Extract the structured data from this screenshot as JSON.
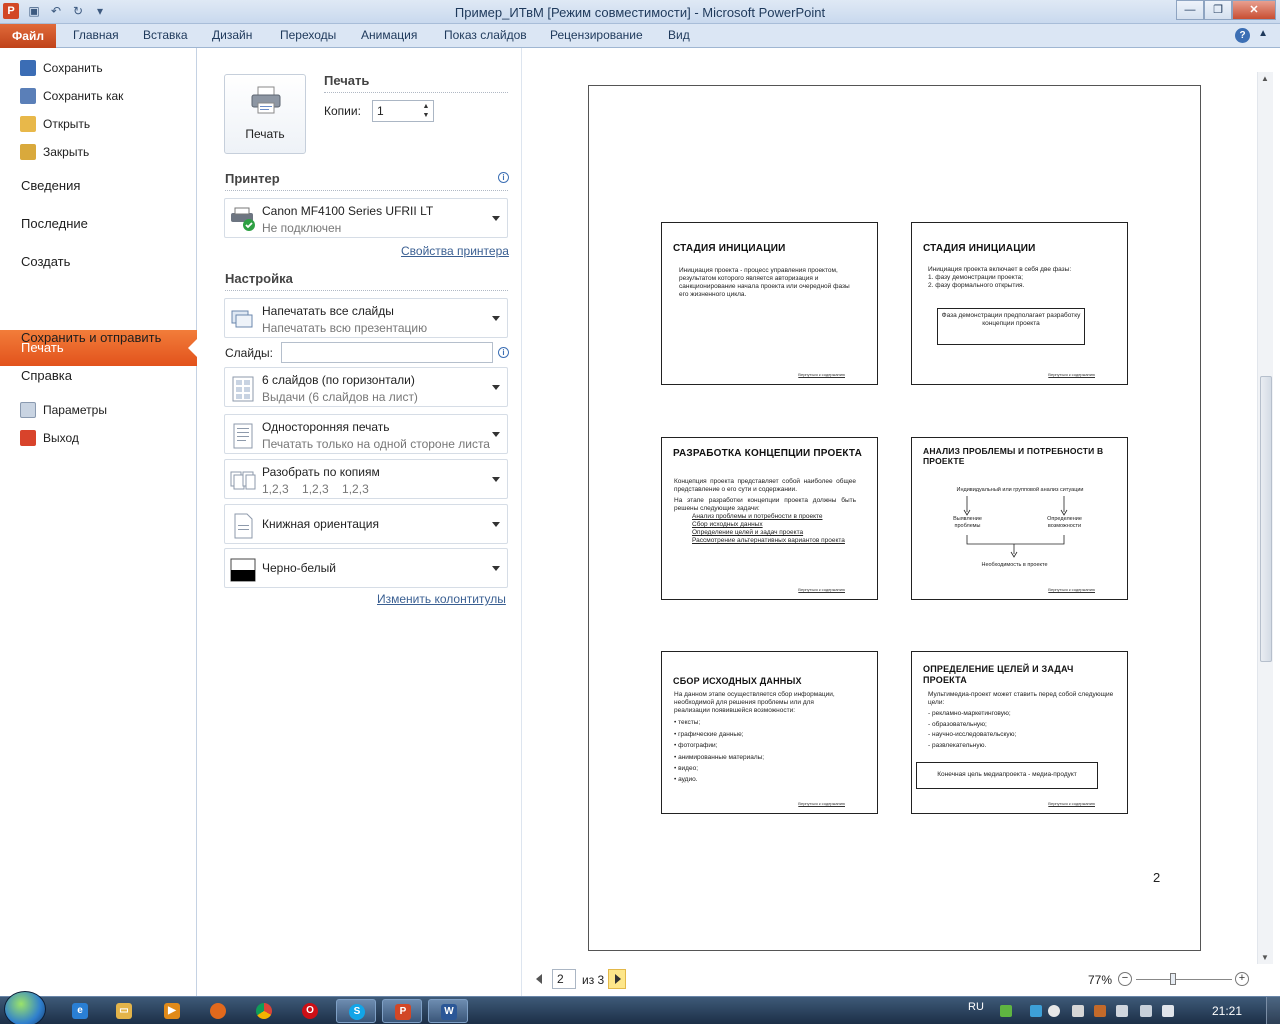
{
  "window": {
    "title": "Пример_ИТвМ [Режим совместимости]  -  Microsoft PowerPoint"
  },
  "ribbon": {
    "file_tab": "Файл",
    "tabs": [
      "Главная",
      "Вставка",
      "Дизайн",
      "Переходы",
      "Анимация",
      "Показ слайдов",
      "Рецензирование",
      "Вид"
    ]
  },
  "backstage_menu": {
    "save": "Сохранить",
    "save_as": "Сохранить как",
    "open": "Открыть",
    "close": "Закрыть",
    "info": "Сведения",
    "recent": "Последние",
    "new": "Создать",
    "print": "Печать",
    "save_send": "Сохранить и отправить",
    "help": "Справка",
    "options": "Параметры",
    "exit": "Выход"
  },
  "print_pane": {
    "print_button": "Печать",
    "heading": "Печать",
    "copies_label": "Копии:",
    "copies_value": "1",
    "printer_heading": "Принтер",
    "printer_name": "Canon MF4100 Series UFRII LT",
    "printer_status": "Не подключен",
    "printer_properties": "Свойства принтера",
    "settings_heading": "Настройка",
    "slides_label": "Слайды:",
    "slides_value": "",
    "what": {
      "t1": "Напечатать все слайды",
      "t2": "Напечатать всю презентацию"
    },
    "layout": {
      "t1": "6 слайдов (по горизонтали)",
      "t2": "Выдачи (6 слайдов на лист)"
    },
    "sides": {
      "t1": "Односторонняя печать",
      "t2": "Печатать только на одной стороне листа"
    },
    "collate": {
      "t1": "Разобрать по копиям",
      "t2": "1,2,3    1,2,3    1,2,3"
    },
    "orientation": "Книжная ориентация",
    "color": "Черно-белый",
    "edit_header": "Изменить колонтитулы"
  },
  "preview": {
    "page_number": "2",
    "slides": [
      {
        "title": "СТАДИЯ  ИНИЦИАЦИИ",
        "body": "Инициация проекта - процесс управления проектом, результатом которого является авторизация и санкционирование  начала проекта  или очередной фазы его  жизненного цикла.",
        "foot": "Вернуться к содержанию"
      },
      {
        "title": "СТАДИЯ  ИНИЦИАЦИИ",
        "intro": "Инициация  проекта  включает  в себя две  фазы:",
        "items": [
          "1.  фазу  демонстрации  проекта;",
          "2.  фазу  формального открытия."
        ],
        "box": "Фаза демонстрации  предполагает разработку  концепции  проекта",
        "foot": "Вернуться к содержанию"
      },
      {
        "title": "РАЗРАБОТКА КОНЦЕПЦИИ ПРОЕКТА",
        "p1": "Концепция  проекта  представляет  собой наиболее общее представление о его сути и содержании.",
        "p2": "На этапе разработки концепции проекта должны быть решены следующие задачи:",
        "items": [
          "Анализ проблемы и потребности  в проекте",
          "Сбор исходных данных",
          "Определение целей и задач проекта",
          "Рассмотрение  альтернативных вариантов проекта"
        ],
        "foot": "Вернуться к содержанию"
      },
      {
        "title": "АНАЛИЗ ПРОБЛЕМЫ И ПОТРЕБНОСТИ В ПРОЕКТЕ",
        "top": "Индивидуальный   или групповой анализ  ситуации",
        "left": "Выявление проблемы",
        "right": "Определение возможности",
        "bottom": "Необходимость  в проекте",
        "foot": "Вернуться к содержанию"
      },
      {
        "title": "СБОР ИСХОДНЫХ ДАННЫХ",
        "p1": "На данном этапе осуществляется сбор информации,  необходимой  для решения проблемы  или для реализации появившейся возможности:",
        "items": [
          "тексты;",
          "графические  данные;",
          "фотографии;",
          "анимированные  материалы;",
          "видео;",
          "аудио."
        ],
        "foot": "Вернуться к содержанию"
      },
      {
        "title": "ОПРЕДЕЛЕНИЕ  ЦЕЛЕЙ И ЗАДАЧ ПРОЕКТА",
        "p1": "Мультимедиа-проект   может ставить перед собой следующие цели:",
        "items": [
          "рекламно-маркетинговую;",
          "образовательную;",
          "научно-исследовательскую;",
          "развлекательную."
        ],
        "box": "Конечная  цель медиапроекта   -  медиа-продукт",
        "foot": "Вернуться к содержанию"
      }
    ]
  },
  "pagenav": {
    "current": "2",
    "of": "из 3"
  },
  "zoom": {
    "value": "77%",
    "level": 0.77
  },
  "taskbar": {
    "lang": "RU",
    "clock": "21:21"
  },
  "colors": {
    "accent": "#e2521c",
    "ribbon": "#dbe6f4"
  }
}
